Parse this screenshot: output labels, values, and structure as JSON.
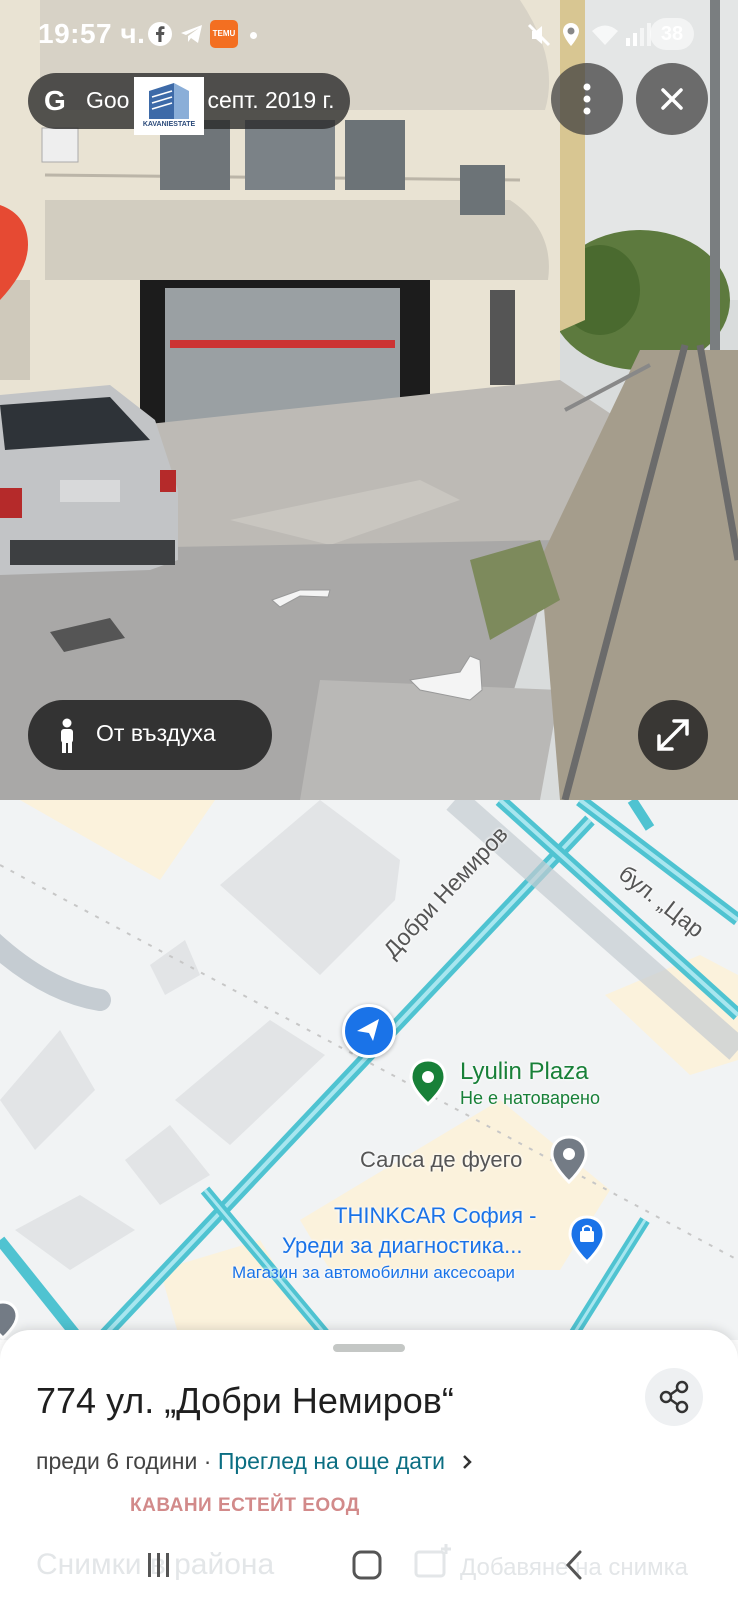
{
  "status_bar": {
    "time": "19:57 ч.",
    "notif_badge": "TEMU",
    "battery": "38"
  },
  "street_view": {
    "capture_label": "Google · септ. 2019 г.",
    "capture_label_visible": "Goo",
    "capture_date_visible": "септ. 2019 г.",
    "logo_text": "KAVANIESTATE",
    "aerial_button_label": "От въздуха"
  },
  "map": {
    "streets": [
      "Добри Немиров",
      "бул. „Цар"
    ],
    "places": [
      {
        "name": "Lyulin Plaza",
        "subtitle": "Не е натоварено"
      },
      {
        "name": "Салса де фуего"
      },
      {
        "name": "THINKCAR София -",
        "name2": "Уреди за диагностика...",
        "subtitle": "Магазин за автомобилни аксесоари"
      }
    ]
  },
  "sheet": {
    "address": "774 ул. „Добри Немиров“",
    "age": "преди 6 години",
    "separator": " · ",
    "more_dates": "Преглед на още дати",
    "company": "КАВАНИ ЕСТЕЙТ ЕООД",
    "ghost_left": "Снимки в района",
    "ghost_right": "Добавяне на снимка"
  },
  "colors": {
    "road_stroke": "#4fc3d1",
    "place_green": "#188038",
    "link_teal": "#0b6e82",
    "thinkcar_blue": "#1a73e8"
  }
}
